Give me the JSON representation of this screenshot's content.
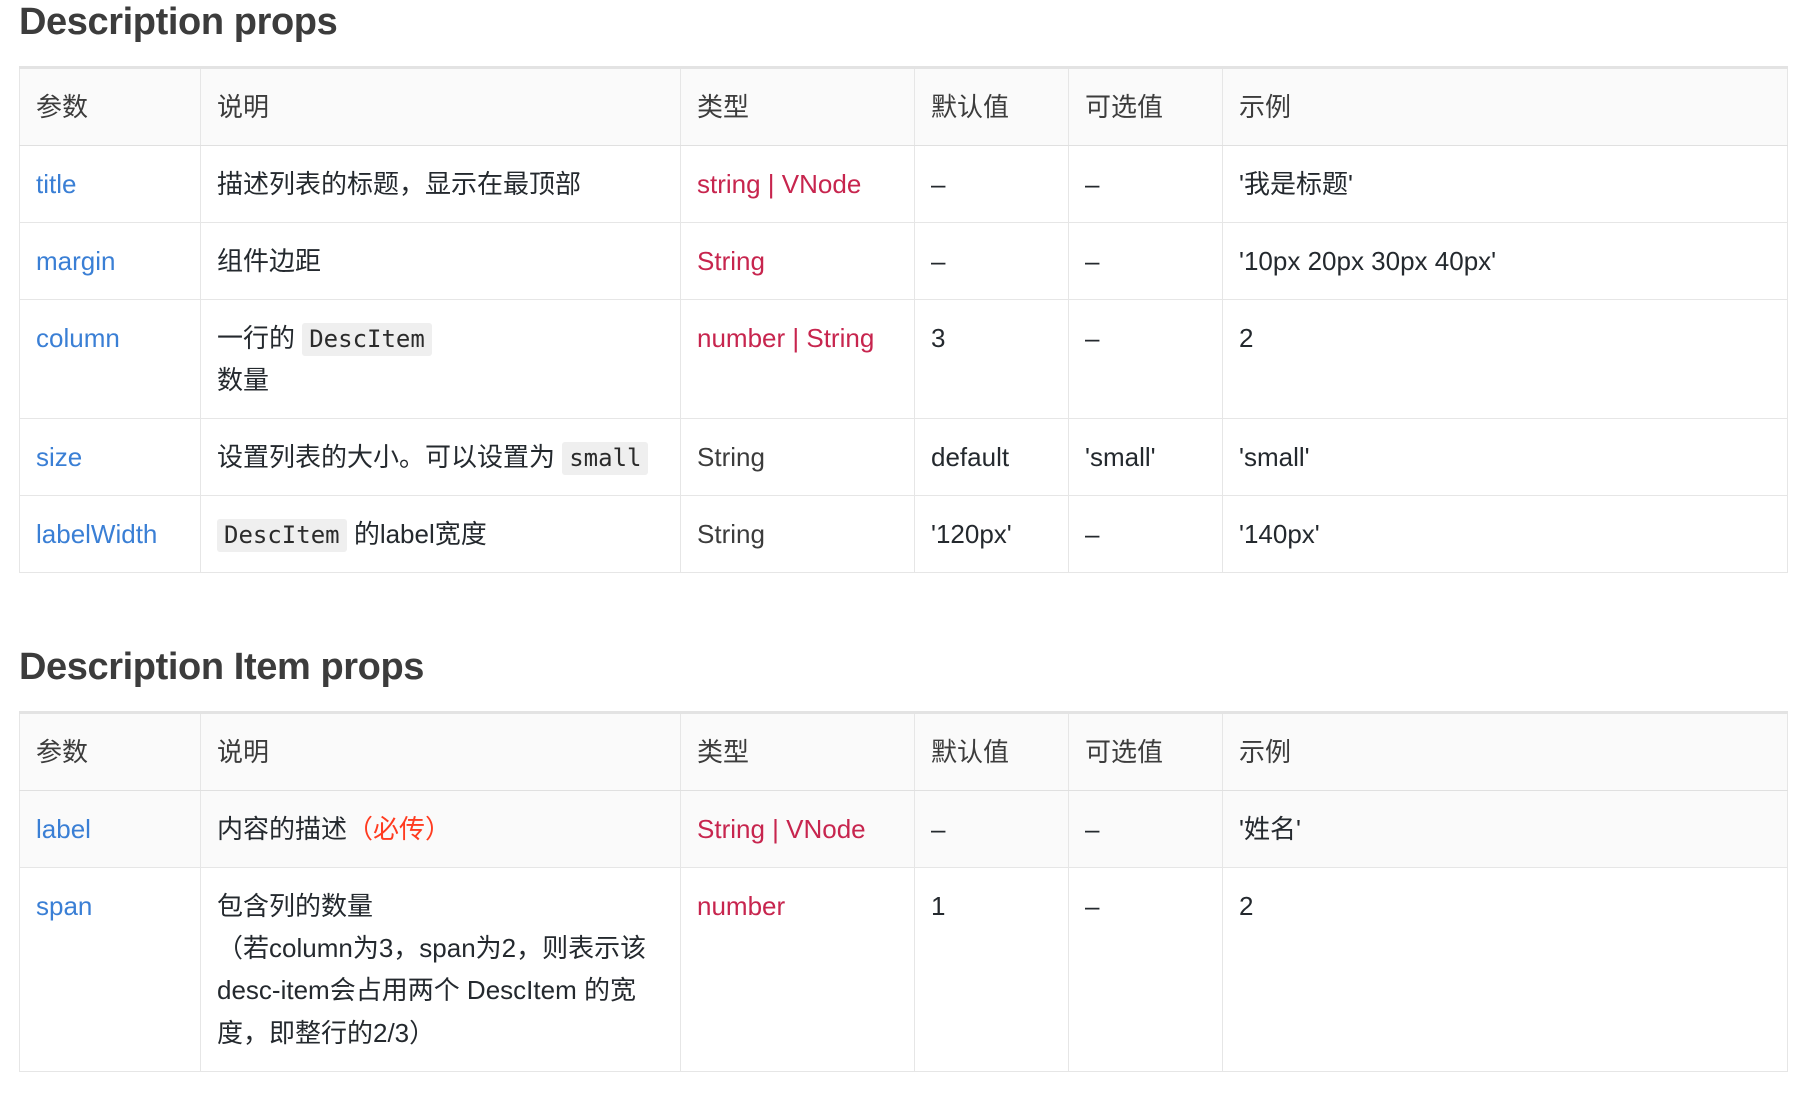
{
  "sections": [
    {
      "heading": "Description props",
      "columns": [
        "参数",
        "说明",
        "类型",
        "默认值",
        "可选值",
        "示例"
      ],
      "rows": [
        {
          "param": "title",
          "desc_text": "描述列表的标题，显示在最顶部",
          "type": "string | VNode",
          "type_style": "highlight",
          "default": "–",
          "optional": "–",
          "example": "'我是标题'"
        },
        {
          "param": "margin",
          "desc_text": "组件边距",
          "type": "String",
          "type_style": "highlight",
          "default": "–",
          "optional": "–",
          "example": "'10px 20px 30px 40px'"
        },
        {
          "param": "column",
          "desc_pre": "一行的 ",
          "desc_code": "DescItem",
          "desc_post": "数量",
          "type": "number | String",
          "type_style": "highlight",
          "default": "3",
          "optional": "–",
          "example": "2"
        },
        {
          "param": "size",
          "desc_pre": "设置列表的大小。可以设置为 ",
          "desc_code": "small",
          "desc_post": "",
          "type": "String",
          "type_style": "plain",
          "default": "default",
          "optional": "'small'",
          "example": "'small'"
        },
        {
          "param": "labelWidth",
          "desc_pre": "",
          "desc_code": "DescItem",
          "desc_post": " 的label宽度",
          "type": "String",
          "type_style": "plain",
          "default": "'120px'",
          "optional": "–",
          "example": "'140px'"
        }
      ]
    },
    {
      "heading": "Description Item props",
      "columns": [
        "参数",
        "说明",
        "类型",
        "默认值",
        "可选值",
        "示例"
      ],
      "rows": [
        {
          "param": "label",
          "desc_text": "内容的描述",
          "desc_required": "（必传）",
          "type": "String | VNode",
          "type_style": "highlight",
          "default": "–",
          "optional": "–",
          "example": "'姓名'"
        },
        {
          "param": "span",
          "desc_line1": "包含列的数量",
          "desc_line2": "（若column为3，span为2，则表示该desc-item会占用两个 DescItem 的宽度，即整行的2/3）",
          "type": "number",
          "type_style": "highlight",
          "default": "1",
          "optional": "–",
          "example": "2"
        }
      ]
    }
  ]
}
